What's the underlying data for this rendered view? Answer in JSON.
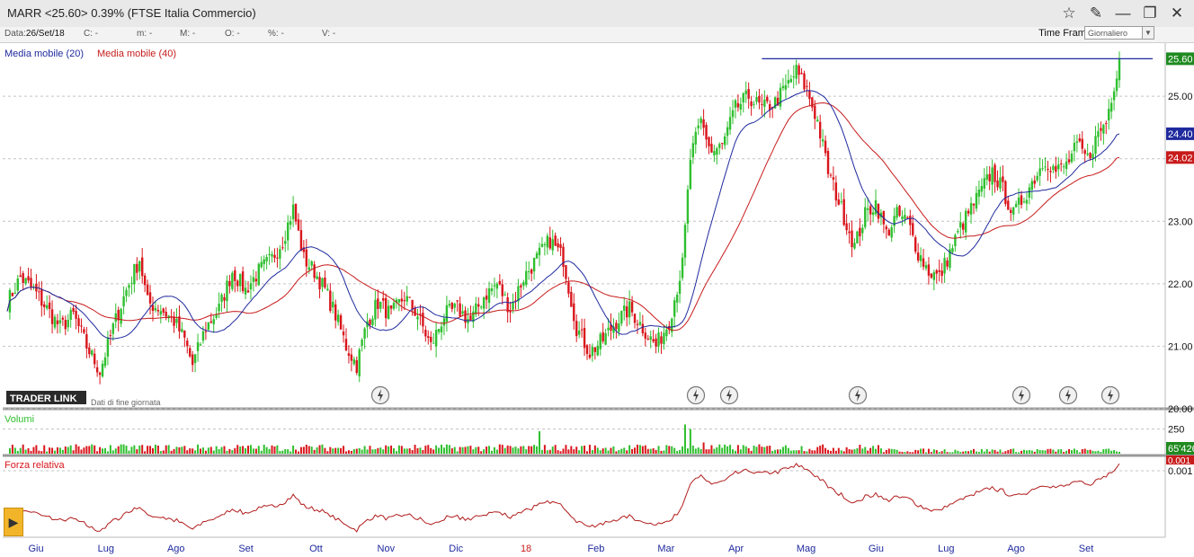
{
  "window": {
    "title": "MARR <25.60> 0.39%  (FTSE Italia Commercio)",
    "icons": [
      "star-icon",
      "pin-icon",
      "minimize-icon",
      "restore-icon",
      "close-icon"
    ]
  },
  "infobar": {
    "data_label": "Data:",
    "data_value": "26/Set/18",
    "c_label": "C: -",
    "m_label": "m: -",
    "M_label": "M: -",
    "O_label": "O: -",
    "pct_label": "%: -",
    "V_label": "V: -",
    "timeframe_label": "Time Frame",
    "timeframe_value": "Giornaliero"
  },
  "legend": {
    "ma20": "Media mobile (20)",
    "ma40": "Media mobile (40)",
    "ma20_color": "#1f2a9e",
    "ma40_color": "#c81b1b"
  },
  "branding": {
    "logo_text": "TRADER LINK",
    "note": "Dati di fine giornata"
  },
  "colors": {
    "up": "#2fbf2f",
    "down": "#d9151b",
    "last_price_badge": "#1f8a1f",
    "resistance": "#1f2a9e"
  },
  "chart_data": [
    {
      "type": "candlestick",
      "title": "MARR",
      "ylim": [
        20.0,
        25.85
      ],
      "y_ticks": [
        "20.00",
        "21.00",
        "22.00",
        "23.00",
        "24.00",
        "25.00"
      ],
      "x_tick_labels": [
        "Giu",
        "Lug",
        "Ago",
        "Set",
        "Ott",
        "Nov",
        "Dic",
        "18",
        "Feb",
        "Mar",
        "Apr",
        "Mag",
        "Giu",
        "Lug",
        "Ago",
        "Set"
      ],
      "last_price": "25.60",
      "ma20_last": "24.40",
      "ma40_last": "24.02",
      "resistance_level": 25.6,
      "close_anchors": [
        [
          0,
          21.7
        ],
        [
          5,
          22.1
        ],
        [
          10,
          21.9
        ],
        [
          15,
          21.6
        ],
        [
          20,
          21.3
        ],
        [
          25,
          21.5
        ],
        [
          30,
          21.0
        ],
        [
          35,
          20.6
        ],
        [
          40,
          21.3
        ],
        [
          45,
          21.9
        ],
        [
          50,
          22.4
        ],
        [
          53,
          21.7
        ],
        [
          58,
          21.6
        ],
        [
          63,
          21.4
        ],
        [
          67,
          21.1
        ],
        [
          70,
          20.7
        ],
        [
          75,
          21.3
        ],
        [
          80,
          21.6
        ],
        [
          85,
          22.2
        ],
        [
          90,
          21.9
        ],
        [
          95,
          22.2
        ],
        [
          100,
          22.4
        ],
        [
          104,
          22.7
        ],
        [
          108,
          23.2
        ],
        [
          112,
          22.4
        ],
        [
          116,
          22.2
        ],
        [
          120,
          21.9
        ],
        [
          124,
          21.5
        ],
        [
          128,
          21.0
        ],
        [
          132,
          20.7
        ],
        [
          136,
          21.4
        ],
        [
          140,
          21.7
        ],
        [
          145,
          21.5
        ],
        [
          150,
          21.8
        ],
        [
          155,
          21.5
        ],
        [
          160,
          21.0
        ],
        [
          165,
          21.5
        ],
        [
          170,
          21.6
        ],
        [
          175,
          21.4
        ],
        [
          180,
          21.8
        ],
        [
          185,
          22.0
        ],
        [
          190,
          21.6
        ],
        [
          195,
          22.1
        ],
        [
          200,
          22.4
        ],
        [
          205,
          22.7
        ],
        [
          210,
          22.4
        ],
        [
          215,
          21.3
        ],
        [
          220,
          20.9
        ],
        [
          225,
          21.1
        ],
        [
          230,
          21.4
        ],
        [
          235,
          21.6
        ],
        [
          240,
          21.3
        ],
        [
          245,
          21.0
        ],
        [
          250,
          21.4
        ],
        [
          255,
          22.3
        ],
        [
          258,
          24.0
        ],
        [
          262,
          24.6
        ],
        [
          266,
          24.1
        ],
        [
          270,
          24.2
        ],
        [
          275,
          24.8
        ],
        [
          280,
          25.0
        ],
        [
          285,
          24.8
        ],
        [
          290,
          24.9
        ],
        [
          295,
          25.2
        ],
        [
          298,
          25.4
        ],
        [
          302,
          25.1
        ],
        [
          306,
          24.6
        ],
        [
          310,
          23.8
        ],
        [
          315,
          23.2
        ],
        [
          320,
          22.6
        ],
        [
          324,
          23.1
        ],
        [
          328,
          23.3
        ],
        [
          332,
          22.8
        ],
        [
          336,
          23.1
        ],
        [
          340,
          23.0
        ],
        [
          344,
          22.5
        ],
        [
          348,
          22.2
        ],
        [
          352,
          22.1
        ],
        [
          356,
          22.5
        ],
        [
          360,
          22.9
        ],
        [
          364,
          23.2
        ],
        [
          368,
          23.5
        ],
        [
          372,
          23.8
        ],
        [
          376,
          23.5
        ],
        [
          380,
          23.1
        ],
        [
          384,
          23.4
        ],
        [
          388,
          23.7
        ],
        [
          392,
          24.0
        ],
        [
          396,
          23.8
        ],
        [
          400,
          23.9
        ],
        [
          404,
          24.2
        ],
        [
          408,
          24.0
        ],
        [
          412,
          24.4
        ],
        [
          415,
          24.6
        ],
        [
          418,
          25.2
        ],
        [
          420,
          25.6
        ]
      ]
    },
    {
      "type": "bar",
      "title": "Volumi",
      "y_ticks": [
        "250"
      ],
      "last_value": "65'426",
      "spikes": [
        [
          201,
          10
        ],
        [
          256,
          13
        ],
        [
          258,
          11
        ],
        [
          263,
          5
        ],
        [
          293,
          3
        ],
        [
          318,
          2
        ]
      ]
    },
    {
      "type": "line",
      "title": "Forza relativa",
      "y_ticks": [
        "0.001"
      ],
      "last_value": "0.001"
    }
  ]
}
